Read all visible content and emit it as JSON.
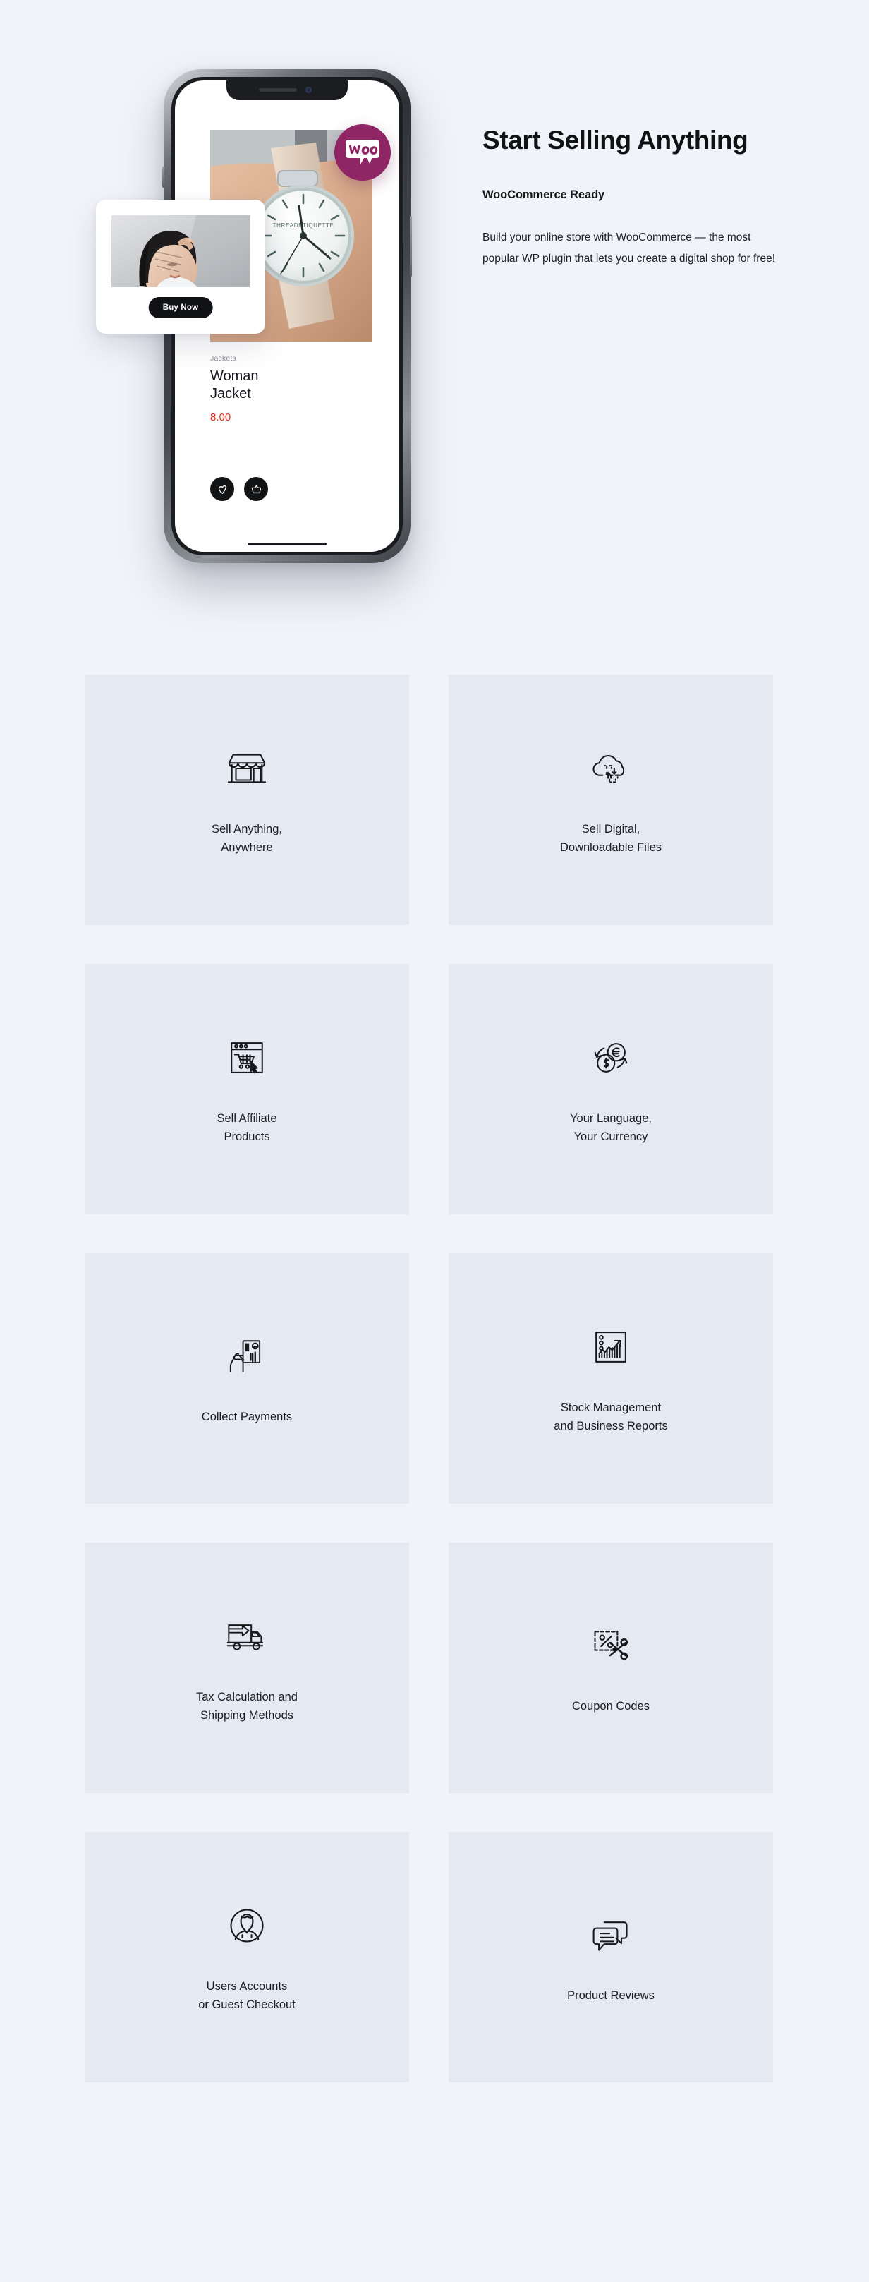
{
  "hero": {
    "title": "Start Selling Anything",
    "subtitle": "WooCommerce Ready",
    "body": "Build your online store with WooCommerce —  the most popular WP plugin that lets you create a digital shop for free!",
    "badge_label": "Woo",
    "accent_color": "#8f2565",
    "background_color": "#f1f3f8"
  },
  "phone": {
    "product": {
      "category": "Jackets",
      "title": "Woman Jacket",
      "price": "8.00",
      "price_color": "#ea2d18"
    },
    "actions": {
      "wishlist_label": "heart-icon",
      "cart_label": "basket-icon"
    }
  },
  "float_card": {
    "buy_label": "Buy Now"
  },
  "features": {
    "card_background": "#e5e9f2",
    "items": [
      {
        "icon": "storefront-icon",
        "label": "Sell Anything,\nAnywhere"
      },
      {
        "icon": "cloud-download-icon",
        "label": "Sell Digital,\nDownloadable Files"
      },
      {
        "icon": "browser-cart-icon",
        "label": "Sell Affiliate\nProducts"
      },
      {
        "icon": "currency-exchange-icon",
        "label": "Your Language,\nYour Currency"
      },
      {
        "icon": "hand-credit-card-icon",
        "label": "Collect Payments"
      },
      {
        "icon": "bar-chart-growth-icon",
        "label": "Stock Management\nand Business Reports"
      },
      {
        "icon": "delivery-truck-icon",
        "label": "Tax Calculation and\nShipping Methods"
      },
      {
        "icon": "coupon-scissors-icon",
        "label": "Coupon Codes"
      },
      {
        "icon": "user-avatar-circle-icon",
        "label": "Users Accounts\nor Guest Checkout"
      },
      {
        "icon": "chat-bubbles-icon",
        "label": "Product Reviews"
      }
    ]
  }
}
